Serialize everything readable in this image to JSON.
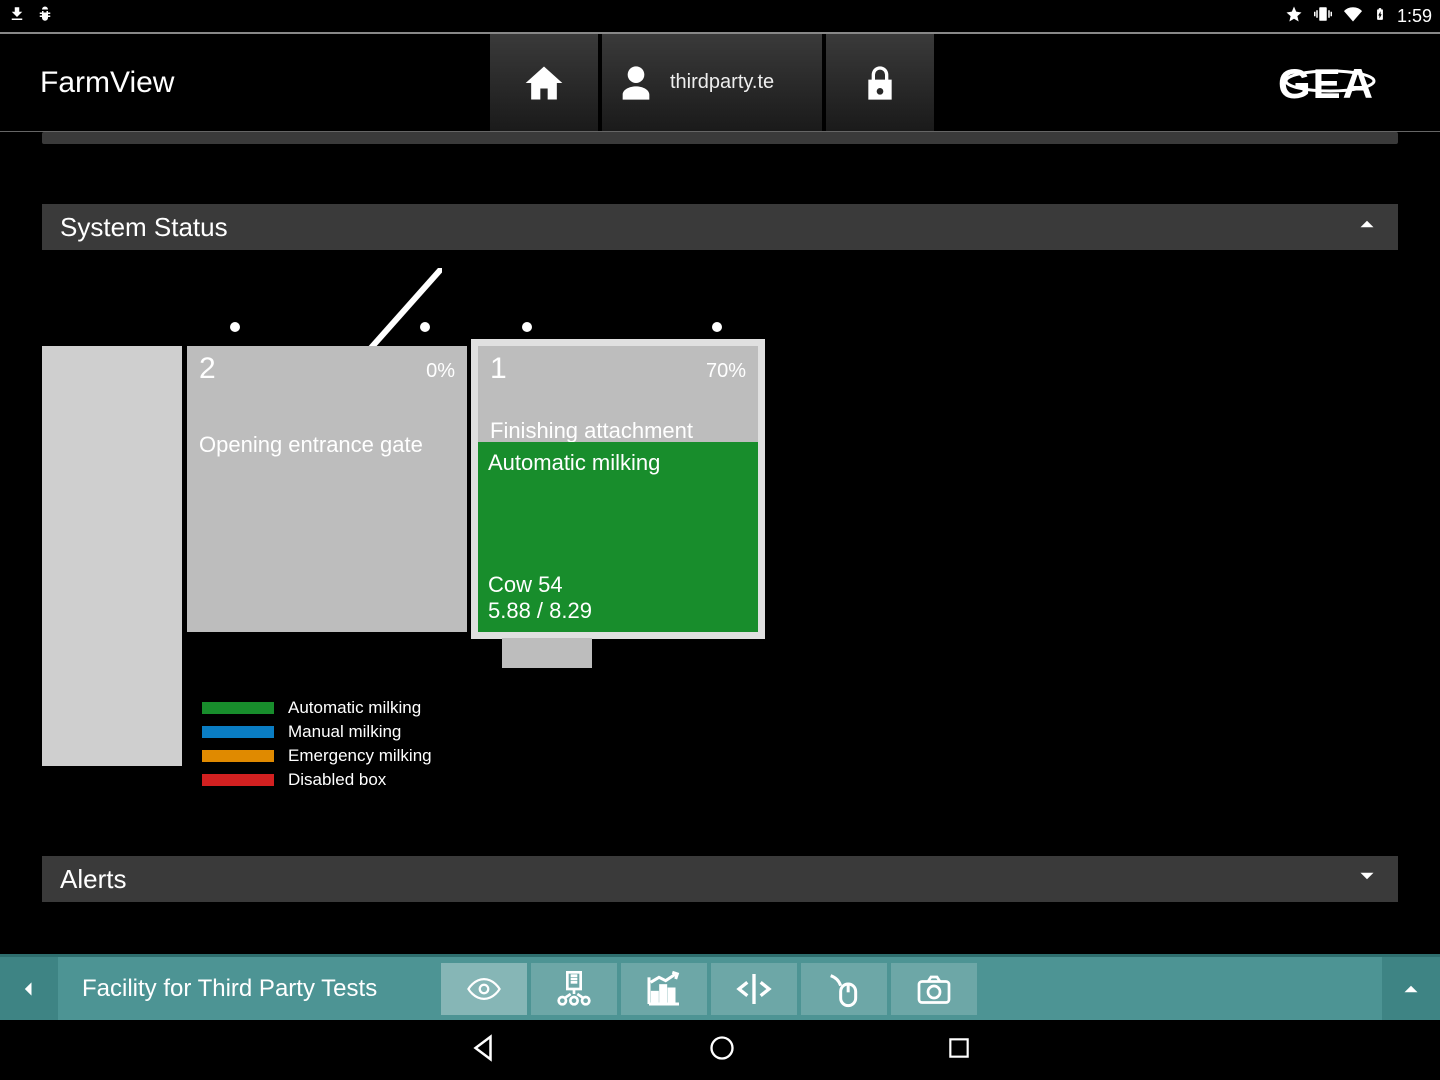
{
  "statusbar": {
    "time": "1:59"
  },
  "header": {
    "app_title": "FarmView",
    "user_label": "thirdparty.te",
    "brand": "GEA"
  },
  "sections": {
    "system_status": {
      "title": "System Status"
    },
    "alerts": {
      "title": "Alerts"
    }
  },
  "boxes": {
    "b2": {
      "num": "2",
      "pct": "0%",
      "status": "Opening entrance gate"
    },
    "b1": {
      "num": "1",
      "pct": "70%",
      "status": "Finishing attachment",
      "mode": "Automatic milking",
      "cow": "Cow 54",
      "yield": "5.88 / 8.29"
    }
  },
  "legend": {
    "auto": "Automatic milking",
    "manual": "Manual milking",
    "emergency": "Emergency milking",
    "disabled": "Disabled box"
  },
  "bottom": {
    "facility": "Facility for Third Party Tests"
  },
  "colors": {
    "teal": "#4d9494",
    "green": "#188d2c",
    "blue": "#0a7dc3",
    "orange": "#e08a00",
    "red": "#d22020"
  }
}
